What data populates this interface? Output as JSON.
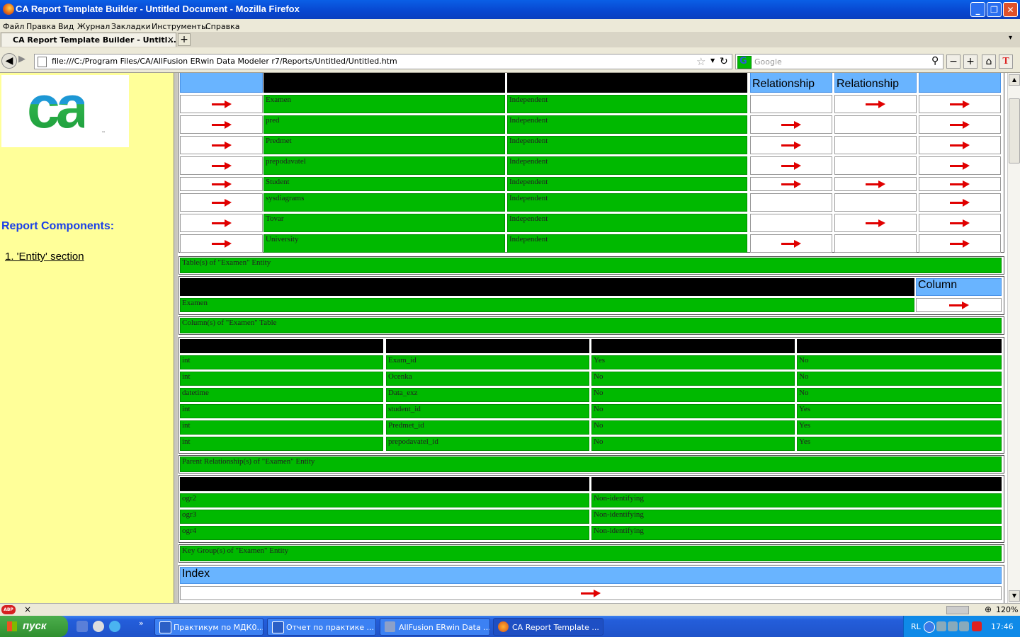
{
  "window": {
    "title": "CA Report Template Builder - Untitled Document - Mozilla Firefox"
  },
  "menu": [
    "Файл",
    "Правка",
    "Вид",
    "Журнал",
    "Закладки",
    "Инструменты",
    "Справка"
  ],
  "tab": {
    "label": "CA Report Template Builder - Untitl...",
    "close": "×",
    "new": "+"
  },
  "nav": {
    "url": "file:///C:/Program Files/CA/AllFusion ERwin Data Modeler r7/Reports/Untitled/Untitled.htm",
    "search_placeholder": "Google"
  },
  "sidebar": {
    "title": "Report Components:",
    "items": [
      "1. 'Entity' section"
    ]
  },
  "entity_table": {
    "headers": [
      "Relationship",
      "Relationship"
    ],
    "rows": [
      {
        "name": "Examen",
        "type": "Independent",
        "child": false,
        "parent": true,
        "key": true
      },
      {
        "name": "pred",
        "type": "Independent",
        "child": true,
        "parent": false,
        "key": true
      },
      {
        "name": "Predmet",
        "type": "Independent",
        "child": true,
        "parent": false,
        "key": true
      },
      {
        "name": "prepodavatel",
        "type": "Independent",
        "child": true,
        "parent": false,
        "key": true
      },
      {
        "name": "Student",
        "type": "Independent",
        "child": true,
        "parent": true,
        "key": true
      },
      {
        "name": "sysdiagrams",
        "type": "Independent",
        "child": false,
        "parent": false,
        "key": true
      },
      {
        "name": "Tovar",
        "type": "Independent",
        "child": false,
        "parent": true,
        "key": true
      },
      {
        "name": "University",
        "type": "Independent",
        "child": true,
        "parent": false,
        "key": true
      }
    ]
  },
  "tables_section": {
    "title": "Table(s) of \"Examen\" Entity",
    "col_header": "Column",
    "row": "Examen"
  },
  "columns_section": {
    "title": "Column(s) of \"Examen\" Table",
    "rows": [
      [
        "int",
        "Exam_id",
        "Yes",
        "No"
      ],
      [
        "int",
        "Ocenka",
        "No",
        "No"
      ],
      [
        "datetime",
        "Data_exz",
        "No",
        "No"
      ],
      [
        "int",
        "student_id",
        "No",
        "Yes"
      ],
      [
        "int",
        "Predmet_id",
        "No",
        "Yes"
      ],
      [
        "int",
        "prepodavatel_id",
        "No",
        "Yes"
      ]
    ]
  },
  "parent_section": {
    "title": "Parent Relationship(s) of \"Examen\" Entity",
    "rows": [
      [
        "ogr2",
        "Non-identifying"
      ],
      [
        "ogr3",
        "Non-identifying"
      ],
      [
        "ogr4",
        "Non-identifying"
      ]
    ]
  },
  "key_section": {
    "title": "Key Group(s) of \"Examen\" Entity",
    "header": "Index"
  },
  "status": {
    "zoom": "120%"
  },
  "taskbar": {
    "start": "пуск",
    "tasks": [
      "Практикум по МДК0...",
      "Отчет по практике ...",
      "AllFusion ERwin Data ...",
      "CA Report Template ..."
    ],
    "lang": "RL",
    "clock": "17:46"
  }
}
